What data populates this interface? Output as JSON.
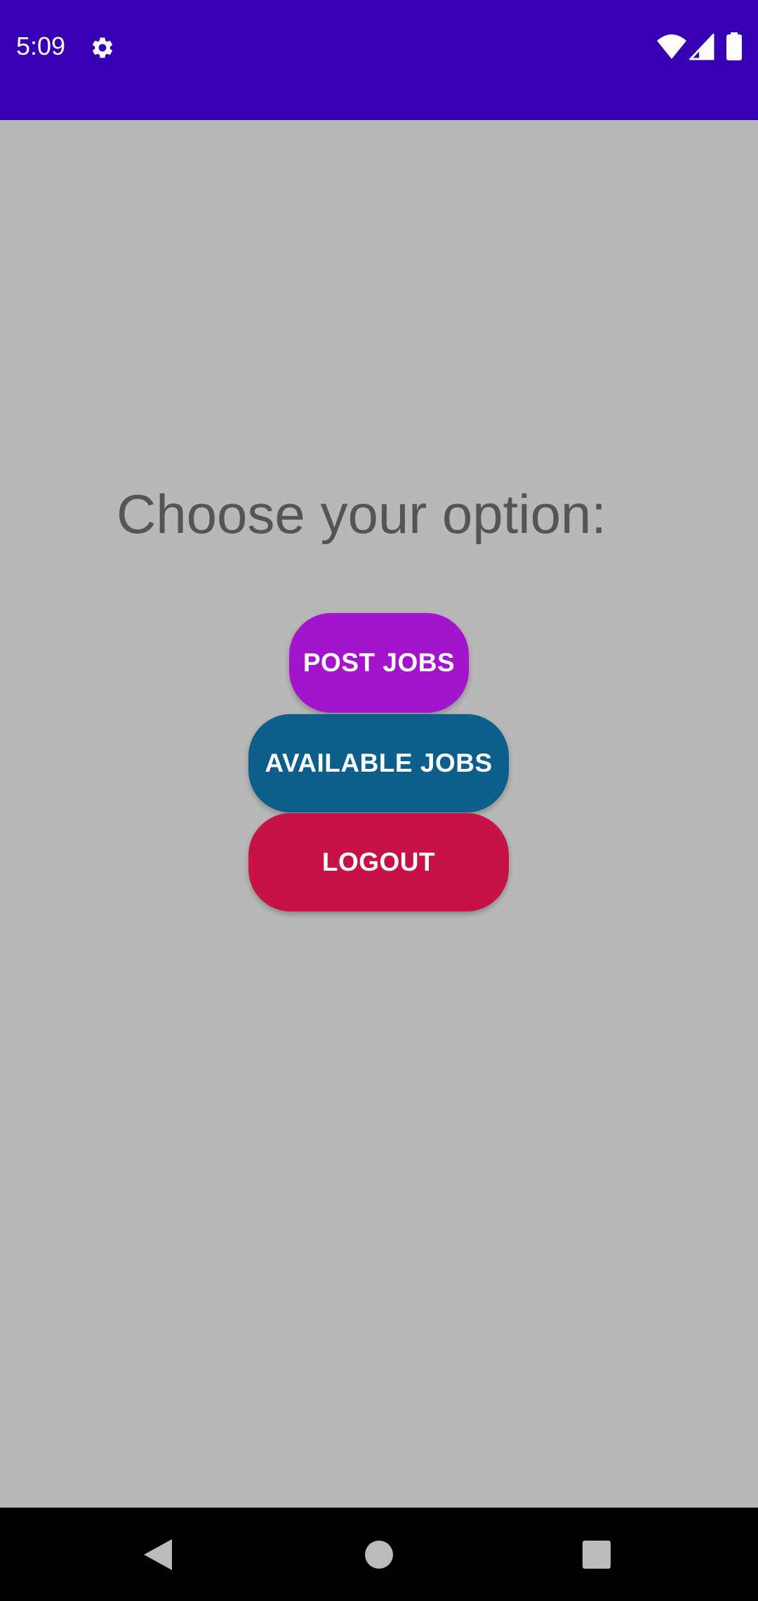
{
  "status_bar": {
    "time": "5:09",
    "icons": [
      "gear-icon",
      "wifi-icon",
      "cellular-signal-icon",
      "battery-icon"
    ],
    "background_color": "#3700b3"
  },
  "main": {
    "prompt": "Choose your option:",
    "buttons": [
      {
        "label": "POST JOBS",
        "color": "#a514cd"
      },
      {
        "label": "AVAILABLE JOBS",
        "color": "#0e5e8b"
      },
      {
        "label": "LOGOUT",
        "color": "#c61244"
      }
    ],
    "background_color": "#b8b8b8"
  },
  "nav_bar": {
    "icons": [
      "back-icon",
      "home-icon",
      "recents-icon"
    ]
  }
}
